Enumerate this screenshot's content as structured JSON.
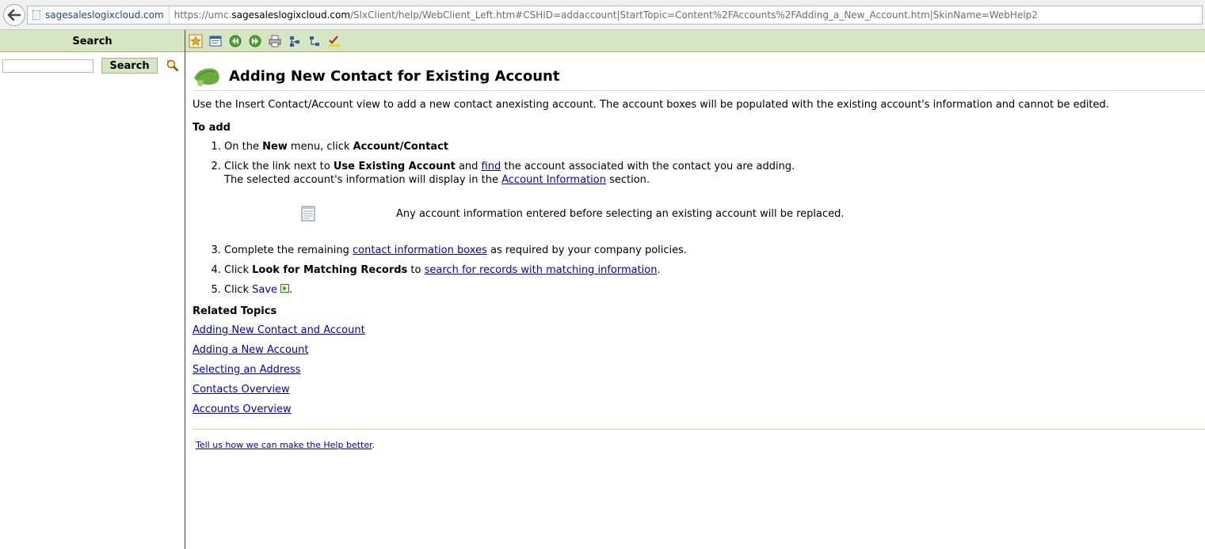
{
  "browser": {
    "site_identity": "sagesaleslogixcloud.com",
    "url_prefix": "https://umc.",
    "url_host": "sagesaleslogixcloud.com",
    "url_path": "/SlxClient/help/WebClient_Left.htm#CSHID=addaccount|StartTopic=Content%2FAccounts%2FAdding_a_New_Account.htm|SkinName=WebHelp2"
  },
  "nav": {
    "header": "Search",
    "search_value": "",
    "search_button": "Search"
  },
  "toolbar": {
    "buttons": [
      "quick-help-icon",
      "toc-icon",
      "previous-topic-icon",
      "next-topic-icon",
      "print-icon",
      "expand-all-icon",
      "collapse-all-icon",
      "remove-highlight-icon"
    ]
  },
  "topic": {
    "title": "Adding New Contact for Existing Account",
    "intro": "Use the Insert Contact/Account view to add a new contact anexisting account. The account boxes will be populated with the existing account's information and cannot be edited.",
    "to_add": "To add",
    "step1": {
      "a": "On the ",
      "b": "New",
      "c": " menu, click ",
      "d": "Account/Contact"
    },
    "step2": {
      "a": "Click the link next to ",
      "b": "Use Existing Account",
      "c": " and ",
      "link1": "find",
      "d": " the account associated with the contact you are adding.",
      "e": "The selected account's information will display in the ",
      "link2": "Account Information",
      "f": " section."
    },
    "note": "Any account information entered before selecting an existing account will be replaced.",
    "step3": {
      "a": "Complete the remaining ",
      "link": "contact information boxes",
      "b": " as required by your company policies."
    },
    "step4": {
      "a": "Click ",
      "b": "Look for Matching Records",
      "c": " to ",
      "link": "search for records with matching information",
      "d": "."
    },
    "step5": {
      "a": "Click ",
      "link": "Save",
      "b": "."
    },
    "related_heading": "Related Topics",
    "related": [
      "Adding New Contact and Account",
      "Adding a New Account",
      "Selecting an Address",
      "Contacts Overview",
      "Accounts Overview"
    ],
    "feedback_link": "Tell us how we can make the Help better",
    "feedback_end": "."
  },
  "colors": {
    "accent_green": "#d7e6c2",
    "link_blue": "#0000cc"
  }
}
